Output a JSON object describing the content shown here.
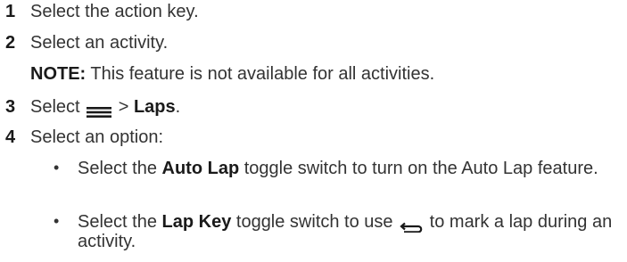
{
  "steps": [
    {
      "number": "1",
      "text": "Select the action key."
    },
    {
      "number": "2",
      "text": "Select an activity."
    },
    {
      "note_label": "NOTE:",
      "note_text": " This feature is not available for all activities."
    },
    {
      "number": "3",
      "pre": "Select ",
      "icon": "menu-icon",
      "mid": " > ",
      "bold": "Laps",
      "post": "."
    },
    {
      "number": "4",
      "text": "Select an option:"
    }
  ],
  "bullets": [
    {
      "pre": "Select the ",
      "bold": "Auto Lap",
      "post": " toggle switch to turn on the Auto Lap feature."
    },
    {
      "pre": "Select the ",
      "bold": "Lap Key",
      "mid": " toggle switch to use ",
      "icon": "back-arrow-icon",
      "post": " to mark a lap during an activity."
    }
  ],
  "bullet_glyph": "•"
}
